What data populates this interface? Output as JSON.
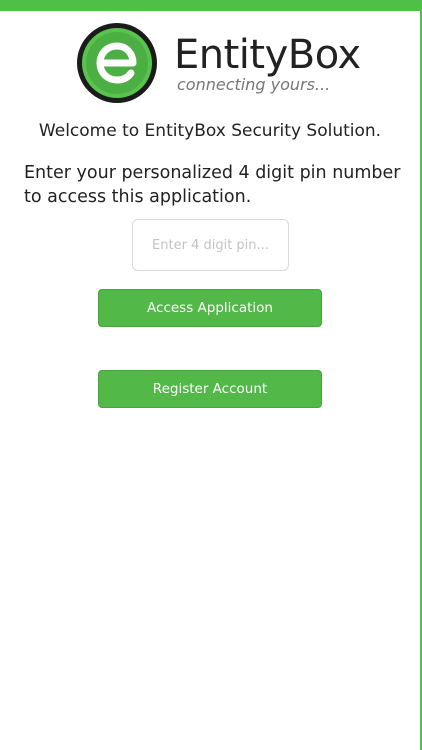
{
  "header": {
    "brand_name": "EntityBox",
    "tagline": "connecting yours...",
    "logo_icon": "entitybox-e-logo-icon",
    "accent_color": "#4fbf48"
  },
  "main": {
    "welcome_text": "Welcome to EntityBox Security Solution.",
    "instructions": "Enter your personalized 4 digit pin number to access this application.",
    "pin_input": {
      "placeholder": "Enter 4 digit pin...",
      "value": ""
    },
    "access_button_label": "Access Application",
    "register_button_label": "Register Account",
    "button_color": "#52b848"
  }
}
